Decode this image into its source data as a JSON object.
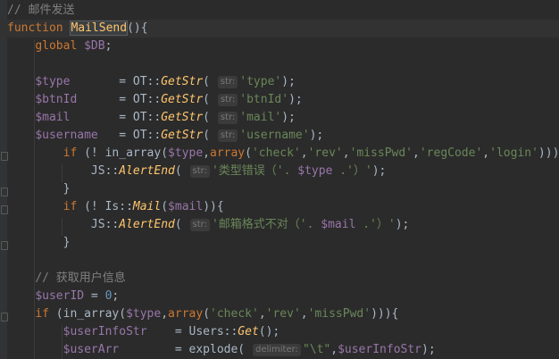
{
  "editor": {
    "lines": [
      [
        {
          "t": "comment",
          "v": "// 邮件发送"
        }
      ],
      [
        {
          "t": "kw",
          "v": "function "
        },
        {
          "t": "fn",
          "v": "MailSend"
        },
        {
          "t": "plain",
          "v": "(){"
        }
      ],
      [
        {
          "t": "plain",
          "v": "    "
        },
        {
          "t": "kw",
          "v": "global "
        },
        {
          "t": "var",
          "v": "$DB"
        },
        {
          "t": "plain",
          "v": ";"
        }
      ],
      [],
      [
        {
          "t": "plain",
          "v": "    "
        },
        {
          "t": "var",
          "v": "$type"
        },
        {
          "t": "plain",
          "v": "       = OT::"
        },
        {
          "t": "static",
          "v": "GetStr"
        },
        {
          "t": "plain",
          "v": "( "
        },
        {
          "t": "hint",
          "v": "str:"
        },
        {
          "t": "str",
          "v": "'type'"
        },
        {
          "t": "plain",
          "v": ");"
        }
      ],
      [
        {
          "t": "plain",
          "v": "    "
        },
        {
          "t": "var",
          "v": "$btnId"
        },
        {
          "t": "plain",
          "v": "      = OT::"
        },
        {
          "t": "static",
          "v": "GetStr"
        },
        {
          "t": "plain",
          "v": "( "
        },
        {
          "t": "hint",
          "v": "str:"
        },
        {
          "t": "str",
          "v": "'btnId'"
        },
        {
          "t": "plain",
          "v": ");"
        }
      ],
      [
        {
          "t": "plain",
          "v": "    "
        },
        {
          "t": "var",
          "v": "$mail"
        },
        {
          "t": "plain",
          "v": "       = OT::"
        },
        {
          "t": "static",
          "v": "GetStr"
        },
        {
          "t": "plain",
          "v": "( "
        },
        {
          "t": "hint",
          "v": "str:"
        },
        {
          "t": "str",
          "v": "'mail'"
        },
        {
          "t": "plain",
          "v": ");"
        }
      ],
      [
        {
          "t": "plain",
          "v": "    "
        },
        {
          "t": "var",
          "v": "$username"
        },
        {
          "t": "plain",
          "v": "   = OT::"
        },
        {
          "t": "static",
          "v": "GetStr"
        },
        {
          "t": "plain",
          "v": "( "
        },
        {
          "t": "hint",
          "v": "str:"
        },
        {
          "t": "str",
          "v": "'username'"
        },
        {
          "t": "plain",
          "v": ");"
        }
      ],
      [
        {
          "t": "plain",
          "v": "        "
        },
        {
          "t": "kw",
          "v": "if "
        },
        {
          "t": "plain",
          "v": "(! in_array("
        },
        {
          "t": "var",
          "v": "$type"
        },
        {
          "t": "plain",
          "v": ","
        },
        {
          "t": "kw",
          "v": "array"
        },
        {
          "t": "plain",
          "v": "("
        },
        {
          "t": "str",
          "v": "'check'"
        },
        {
          "t": "plain",
          "v": ","
        },
        {
          "t": "str",
          "v": "'rev'"
        },
        {
          "t": "plain",
          "v": ","
        },
        {
          "t": "str",
          "v": "'missPwd'"
        },
        {
          "t": "plain",
          "v": ","
        },
        {
          "t": "str",
          "v": "'regCode'"
        },
        {
          "t": "plain",
          "v": ","
        },
        {
          "t": "str",
          "v": "'login'"
        },
        {
          "t": "plain",
          "v": "))){"
        }
      ],
      [
        {
          "t": "plain",
          "v": "            JS::"
        },
        {
          "t": "static",
          "v": "AlertEnd"
        },
        {
          "t": "plain",
          "v": "( "
        },
        {
          "t": "hint",
          "v": "str:"
        },
        {
          "t": "str",
          "v": "'类型错误（'. "
        },
        {
          "t": "var",
          "v": "$type"
        },
        {
          "t": "str",
          "v": " .'）'"
        },
        {
          "t": "plain",
          "v": ");"
        }
      ],
      [
        {
          "t": "plain",
          "v": "        }"
        }
      ],
      [
        {
          "t": "plain",
          "v": "        "
        },
        {
          "t": "kw",
          "v": "if "
        },
        {
          "t": "plain",
          "v": "(! Is::"
        },
        {
          "t": "static",
          "v": "Mail"
        },
        {
          "t": "plain",
          "v": "("
        },
        {
          "t": "var",
          "v": "$mail"
        },
        {
          "t": "plain",
          "v": ")){"
        }
      ],
      [
        {
          "t": "plain",
          "v": "            JS::"
        },
        {
          "t": "static",
          "v": "AlertEnd"
        },
        {
          "t": "plain",
          "v": "( "
        },
        {
          "t": "hint",
          "v": "str:"
        },
        {
          "t": "str",
          "v": "'邮箱格式不对（'. "
        },
        {
          "t": "var",
          "v": "$mail"
        },
        {
          "t": "str",
          "v": " .'）'"
        },
        {
          "t": "plain",
          "v": ");"
        }
      ],
      [
        {
          "t": "plain",
          "v": "        }"
        }
      ],
      [],
      [
        {
          "t": "plain",
          "v": "    "
        },
        {
          "t": "comment",
          "v": "// 获取用户信息"
        }
      ],
      [
        {
          "t": "plain",
          "v": "    "
        },
        {
          "t": "var",
          "v": "$userID"
        },
        {
          "t": "plain",
          "v": " = "
        },
        {
          "t": "num",
          "v": "0"
        },
        {
          "t": "plain",
          "v": ";"
        }
      ],
      [
        {
          "t": "plain",
          "v": "    "
        },
        {
          "t": "kw",
          "v": "if "
        },
        {
          "t": "plain",
          "v": "(in_array("
        },
        {
          "t": "var",
          "v": "$type"
        },
        {
          "t": "plain",
          "v": ","
        },
        {
          "t": "kw",
          "v": "array"
        },
        {
          "t": "plain",
          "v": "("
        },
        {
          "t": "str",
          "v": "'check'"
        },
        {
          "t": "plain",
          "v": ","
        },
        {
          "t": "str",
          "v": "'rev'"
        },
        {
          "t": "plain",
          "v": ","
        },
        {
          "t": "str",
          "v": "'missPwd'"
        },
        {
          "t": "plain",
          "v": "))){"
        }
      ],
      [
        {
          "t": "plain",
          "v": "        "
        },
        {
          "t": "var",
          "v": "$userInfoStr"
        },
        {
          "t": "plain",
          "v": "    = Users::"
        },
        {
          "t": "static",
          "v": "Get"
        },
        {
          "t": "plain",
          "v": "();"
        }
      ],
      [
        {
          "t": "plain",
          "v": "        "
        },
        {
          "t": "var",
          "v": "$userArr"
        },
        {
          "t": "plain",
          "v": "        = explode( "
        },
        {
          "t": "hint",
          "v": "delimiter:"
        },
        {
          "t": "str",
          "v": "\"\\t\""
        },
        {
          "t": "plain",
          "v": ","
        },
        {
          "t": "var",
          "v": "$userInfoStr"
        },
        {
          "t": "plain",
          "v": ");"
        }
      ]
    ]
  }
}
